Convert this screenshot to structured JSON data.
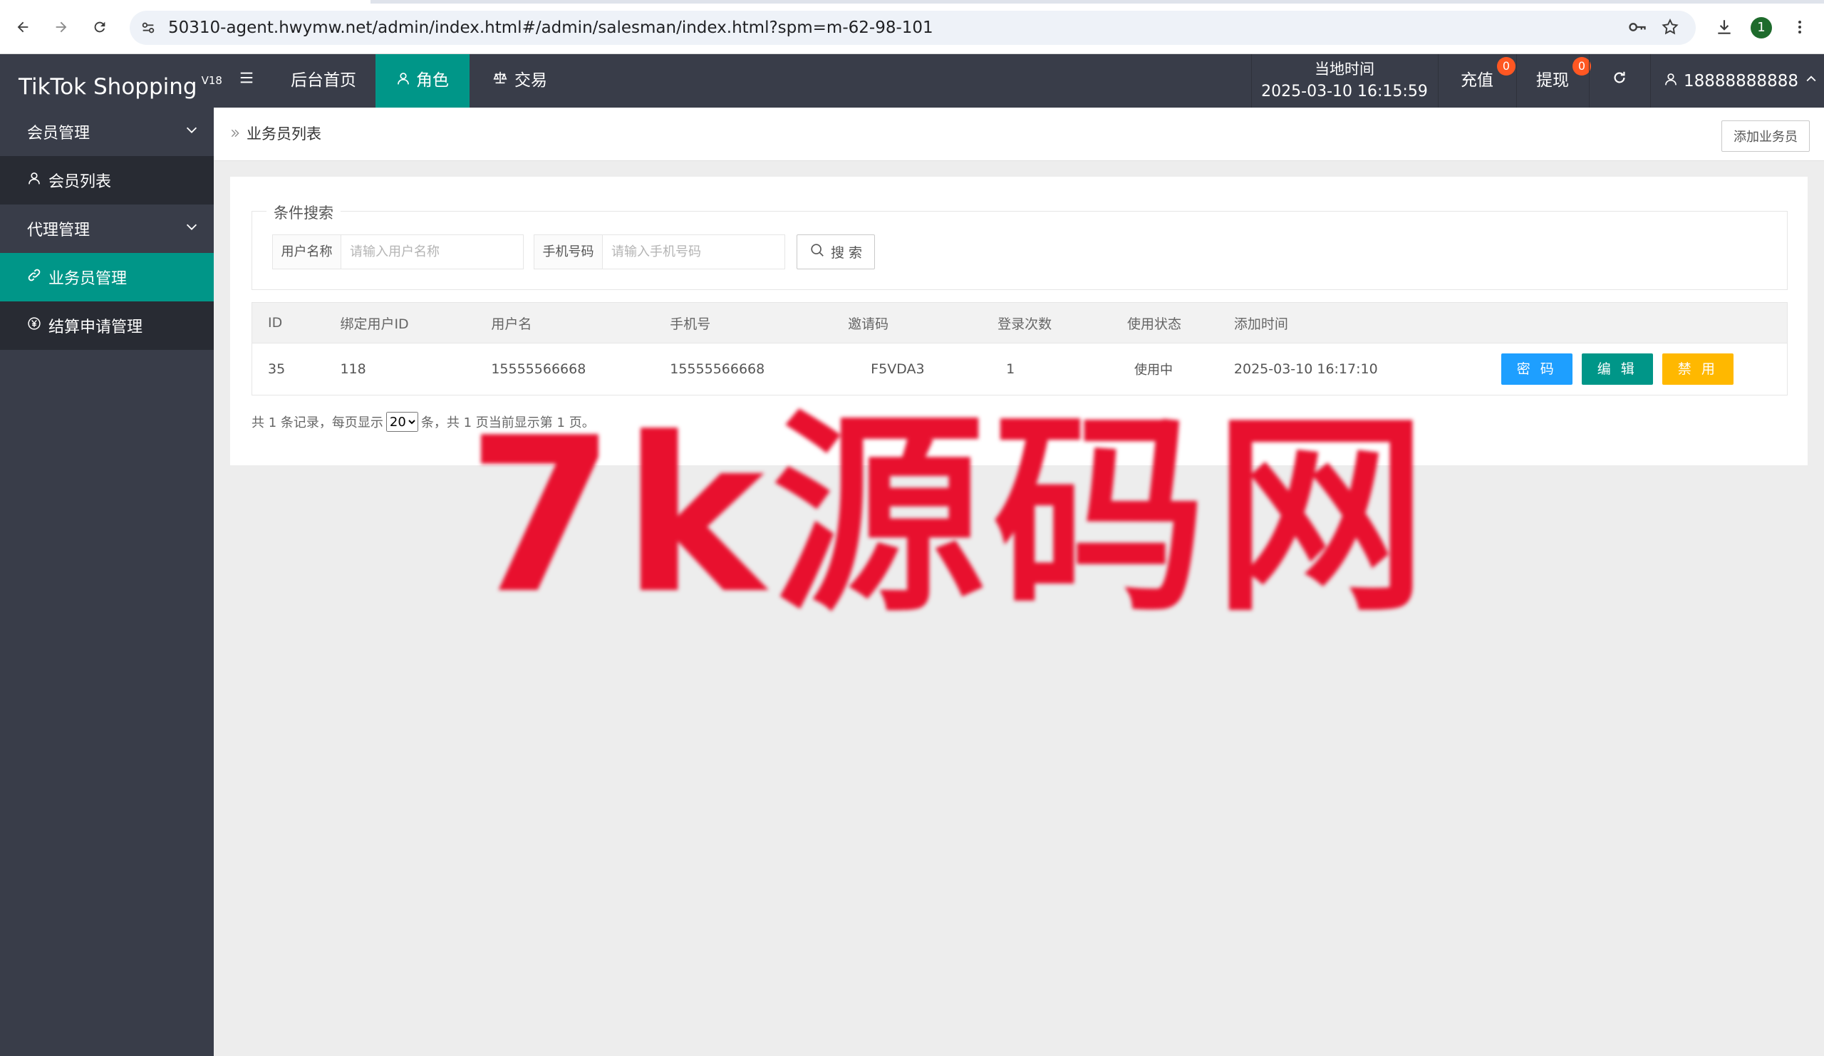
{
  "browser": {
    "url": "50310-agent.hwymw.net/admin/index.html#/admin/salesman/index.html?spm=m-62-98-101",
    "profile_initial": "1"
  },
  "header": {
    "logo": "TikTok Shopping",
    "version": "V18",
    "nav": [
      {
        "label": "后台首页"
      },
      {
        "label": "角色"
      },
      {
        "label": "交易"
      }
    ],
    "time_label": "当地时间",
    "time_value": "2025-03-10 16:15:59",
    "recharge_label": "充值",
    "recharge_badge": "0",
    "withdraw_label": "提现",
    "withdraw_badge": "0",
    "username": "18888888888"
  },
  "sidebar": {
    "groups": [
      {
        "label": "会员管理",
        "items": [
          {
            "label": "会员列表"
          }
        ]
      },
      {
        "label": "代理管理",
        "items": [
          {
            "label": "业务员管理"
          },
          {
            "label": "结算申请管理"
          }
        ]
      }
    ]
  },
  "breadcrumb": {
    "current": "业务员列表",
    "add_button": "添加业务员"
  },
  "search": {
    "legend": "条件搜索",
    "username_label": "用户名称",
    "username_placeholder": "请输入用户名称",
    "phone_label": "手机号码",
    "phone_placeholder": "请输入手机号码",
    "search_button": "搜 索"
  },
  "table": {
    "columns": [
      "ID",
      "绑定用户ID",
      "用户名",
      "手机号",
      "邀请码",
      "登录次数",
      "使用状态",
      "添加时间",
      ""
    ],
    "rows": [
      {
        "id": "35",
        "bind_user_id": "118",
        "username": "15555566668",
        "phone": "15555566668",
        "invite_code": "F5VDA3",
        "login_count": "1",
        "status": "使用中",
        "added_time": "2025-03-10 16:17:10",
        "actions": [
          "密 码",
          "编 辑",
          "禁 用"
        ]
      }
    ]
  },
  "pager": {
    "prefix": "共 1 条记录，每页显示",
    "page_size": "20",
    "suffix": "条，共 1 页当前显示第 1 页。"
  },
  "watermark": "7k源码网",
  "colors": {
    "header_bg": "#393d49",
    "accent": "#009688",
    "blue": "#1e9fff",
    "yellow": "#ffb800",
    "badge": "#ff5722",
    "watermark": "#e8102e"
  }
}
